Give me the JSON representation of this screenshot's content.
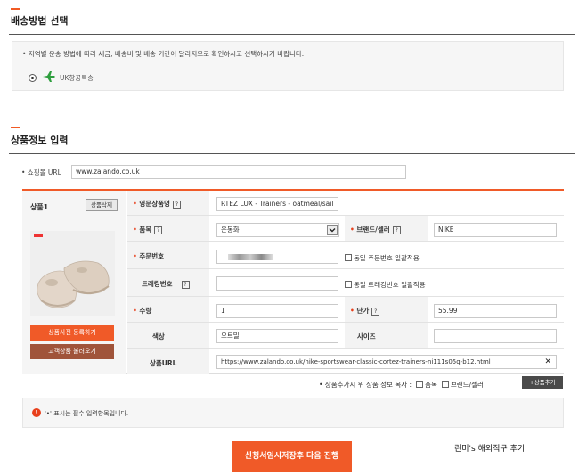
{
  "shipping": {
    "title": "배송방법 선택",
    "notice": "• 지역별 운송 방법에 따라 세금, 배송비 및 배송 기간이 달라지므로 확인하시고 선택하시기 바랍니다.",
    "option_label": "UK항공특송"
  },
  "product": {
    "title": "상품정보 입력",
    "shop_url_label": "• 쇼핑몰 URL",
    "shop_url_value": "www.zalando.co.uk",
    "item_title": "상품1",
    "delete_button": "상품삭제",
    "upload_photo_button": "상품사진 등록하기",
    "past_product_button": "고객상품 불러오기",
    "fields": {
      "name_label": "영문상품명",
      "name_value": "RTEZ LUX - Trainers - oatmeal/sail",
      "category_label": "품목",
      "category_value": "운동화",
      "brand_label": "브랜드/셀러",
      "brand_value": "NIKE",
      "order_no_label": "주문번호",
      "order_no_value": "",
      "same_order_check": "동일 주문번호 일괄적용",
      "tracking_label": "트래킹번호",
      "tracking_value": "",
      "same_tracking_check": "동일 트래킹번호 일괄적용",
      "qty_label": "수량",
      "qty_value": "1",
      "price_label": "단가",
      "price_value": "55.99",
      "color_label": "색상",
      "color_value": "오트밀",
      "size_label": "사이즈",
      "size_value": "",
      "url_label": "상품URL",
      "url_value": "https://www.zalando.co.uk/nike-sportswear-classic-cortez-trainers-ni111s05q-b12.html"
    },
    "copy_row": {
      "label": "• 상품추가시 위 상품 정보 복사 :",
      "check1": "품목",
      "check2": "브랜드/셀러",
      "add_button": "+상품추가"
    },
    "required_notice": "'•' 표시는 필수 입력항목입니다.",
    "submit_button": "신청서임시저장후 다음 진행"
  },
  "watermark": "린미's 해외직구 후기",
  "colors": {
    "accent": "#f05a28",
    "brown": "#a0543a"
  }
}
